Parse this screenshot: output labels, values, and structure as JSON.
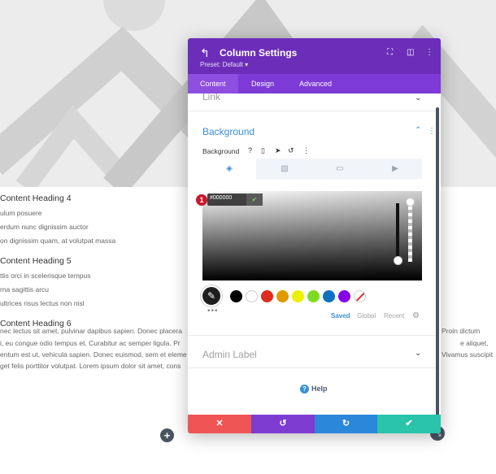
{
  "background_page": {
    "headings": [
      "Content Heading 4",
      "Content Heading 5",
      "Content Heading 6"
    ],
    "heading4_lines": [
      "ulum posuere",
      "erdum nunc dignissim auctor",
      "on dignissim quam, at volutpat massa"
    ],
    "heading5_lines": [
      "ttis orci in scelerisque tempus",
      "rna sagittis arcu",
      "ultrices risus lectus non nisl"
    ],
    "body_lines_left": [
      "nec lectus sit amet, pulvinar dapibus sapien. Donec placera",
      "i, eu congue odio tempus et. Curabitur ac semper ligula. Pr",
      "entum est ut, vehicula sapien. Donec euismod, sem et eleme",
      "get felis porttitor volutpat. Lorem ipsum dolor sit amet, cons"
    ],
    "body_lines_right": [
      "Proin dictum",
      "e aliquet,",
      "Vivamus suscipit"
    ]
  },
  "modal": {
    "title": "Column Settings",
    "preset": "Preset: Default ▾",
    "tabs": [
      "Content",
      "Design",
      "Advanced"
    ],
    "active_tab": "Content",
    "link_section": "Link",
    "background_section": "Background",
    "background_label": "Background",
    "color_value": "#000000",
    "step_badge": "1",
    "swatch_colors": [
      "#000000",
      "#ffffff",
      "#e02b20",
      "#e09900",
      "#edf000",
      "#7cda24",
      "#0c71c3",
      "#8300e9"
    ],
    "palette_tabs": [
      "Saved",
      "Global",
      "Recent"
    ],
    "admin_label": "Admin Label",
    "help_label": "Help"
  },
  "footer_colors": {
    "cancel": "#ef5555",
    "undo": "#7e3bd0",
    "redo": "#2b87da",
    "save": "#29c4a9"
  },
  "accent": "#6c2eb9"
}
